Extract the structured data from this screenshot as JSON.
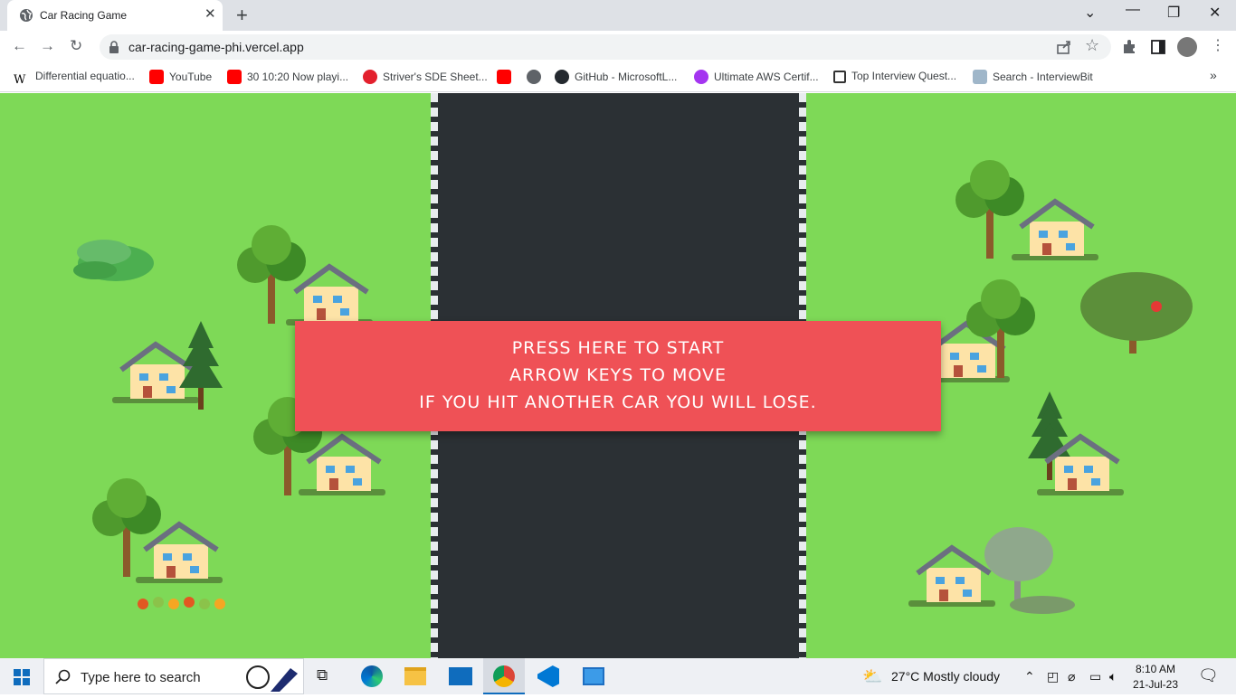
{
  "browser": {
    "tab_title": "Car Racing Game",
    "url": "car-racing-game-phi.vercel.app"
  },
  "bookmarks": [
    {
      "label": "Differential equatio..."
    },
    {
      "label": "YouTube"
    },
    {
      "label": "30 10:20 Now playi..."
    },
    {
      "label": "Striver's SDE Sheet..."
    },
    {
      "label": "GitHub - MicrosoftL..."
    },
    {
      "label": "Ultimate AWS Certif..."
    },
    {
      "label": "Top Interview Quest..."
    },
    {
      "label": "Search - InterviewBit"
    }
  ],
  "game": {
    "start_lines": [
      "PRESS HERE TO START",
      "ARROW KEYS TO MOVE",
      "IF YOU HIT ANOTHER CAR YOU WILL LOSE."
    ]
  },
  "taskbar": {
    "search_placeholder": "Type here to search",
    "weather": "27°C  Mostly cloudy",
    "time": "8:10 AM",
    "date": "21-Jul-23"
  },
  "colors": {
    "grass": "#7ed957",
    "road": "#2b3034",
    "banner": "#ef5156"
  }
}
